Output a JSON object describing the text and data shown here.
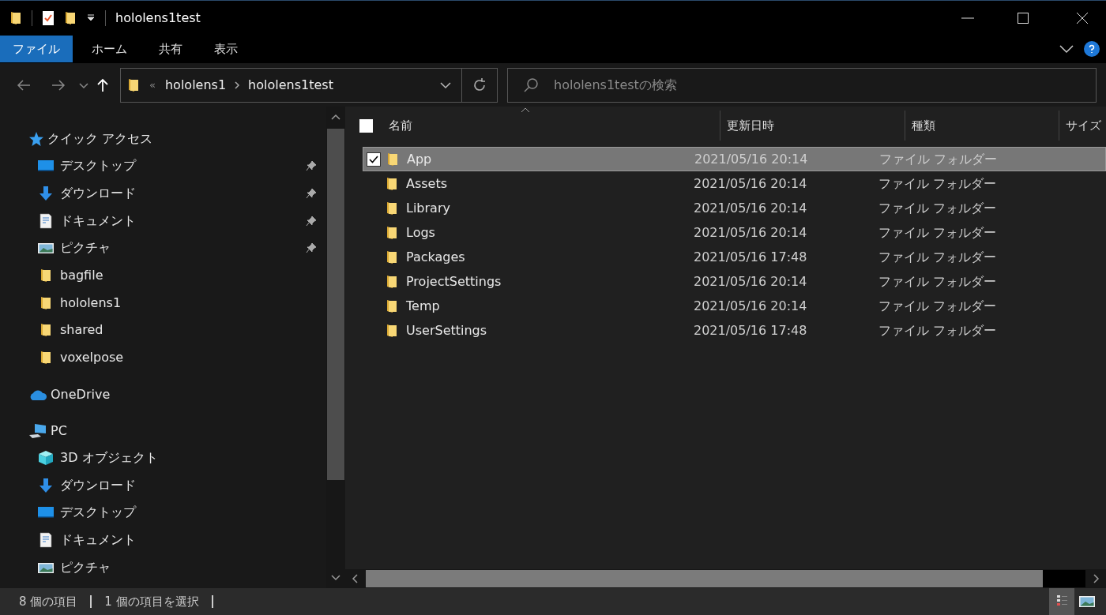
{
  "window": {
    "title": "hololens1test"
  },
  "ribbon_tabs": [
    {
      "label": "ファイル",
      "selected": true
    },
    {
      "label": "ホーム",
      "selected": false
    },
    {
      "label": "共有",
      "selected": false
    },
    {
      "label": "表示",
      "selected": false
    }
  ],
  "address": {
    "overflow": "«",
    "crumbs": [
      "hololens1",
      "hololens1test"
    ]
  },
  "search": {
    "placeholder": "hololens1testの検索"
  },
  "sidebar": {
    "groups": [
      {
        "label": "クイック アクセス",
        "kind": "star",
        "children": [
          {
            "label": "デスクトップ",
            "kind": "desktop",
            "pinned": true
          },
          {
            "label": "ダウンロード",
            "kind": "download",
            "pinned": true
          },
          {
            "label": "ドキュメント",
            "kind": "document",
            "pinned": true
          },
          {
            "label": "ピクチャ",
            "kind": "picture",
            "pinned": true
          },
          {
            "label": "bagfile",
            "kind": "folder",
            "pinned": false
          },
          {
            "label": "hololens1",
            "kind": "folder",
            "pinned": false
          },
          {
            "label": "shared",
            "kind": "folder",
            "pinned": false
          },
          {
            "label": "voxelpose",
            "kind": "folder",
            "pinned": false
          }
        ]
      },
      {
        "label": "OneDrive",
        "kind": "cloud"
      },
      {
        "label": "PC",
        "kind": "pc",
        "children": [
          {
            "label": "3D オブジェクト",
            "kind": "cube",
            "pinned": false
          },
          {
            "label": "ダウンロード",
            "kind": "download",
            "pinned": false
          },
          {
            "label": "デスクトップ",
            "kind": "desktop",
            "pinned": false
          },
          {
            "label": "ドキュメント",
            "kind": "document",
            "pinned": false
          },
          {
            "label": "ピクチャ",
            "kind": "picture",
            "pinned": false
          }
        ]
      }
    ]
  },
  "table": {
    "select_all": {
      "checked": false
    },
    "columns": [
      "名前",
      "更新日時",
      "種類",
      "サイズ"
    ],
    "rows": [
      {
        "name": "App",
        "modified": "2021/05/16 20:14",
        "type": "ファイル フォルダー",
        "selected": true
      },
      {
        "name": "Assets",
        "modified": "2021/05/16 20:14",
        "type": "ファイル フォルダー",
        "selected": false
      },
      {
        "name": "Library",
        "modified": "2021/05/16 20:14",
        "type": "ファイル フォルダー",
        "selected": false
      },
      {
        "name": "Logs",
        "modified": "2021/05/16 20:14",
        "type": "ファイル フォルダー",
        "selected": false
      },
      {
        "name": "Packages",
        "modified": "2021/05/16 17:48",
        "type": "ファイル フォルダー",
        "selected": false
      },
      {
        "name": "ProjectSettings",
        "modified": "2021/05/16 20:14",
        "type": "ファイル フォルダー",
        "selected": false
      },
      {
        "name": "Temp",
        "modified": "2021/05/16 20:14",
        "type": "ファイル フォルダー",
        "selected": false
      },
      {
        "name": "UserSettings",
        "modified": "2021/05/16 17:48",
        "type": "ファイル フォルダー",
        "selected": false
      }
    ]
  },
  "status_bar": {
    "count": "8 個の項目",
    "selection": "1 個の項目を選択"
  },
  "views": [
    {
      "kind": "details",
      "selected": true
    },
    {
      "kind": "large",
      "selected": false
    }
  ]
}
